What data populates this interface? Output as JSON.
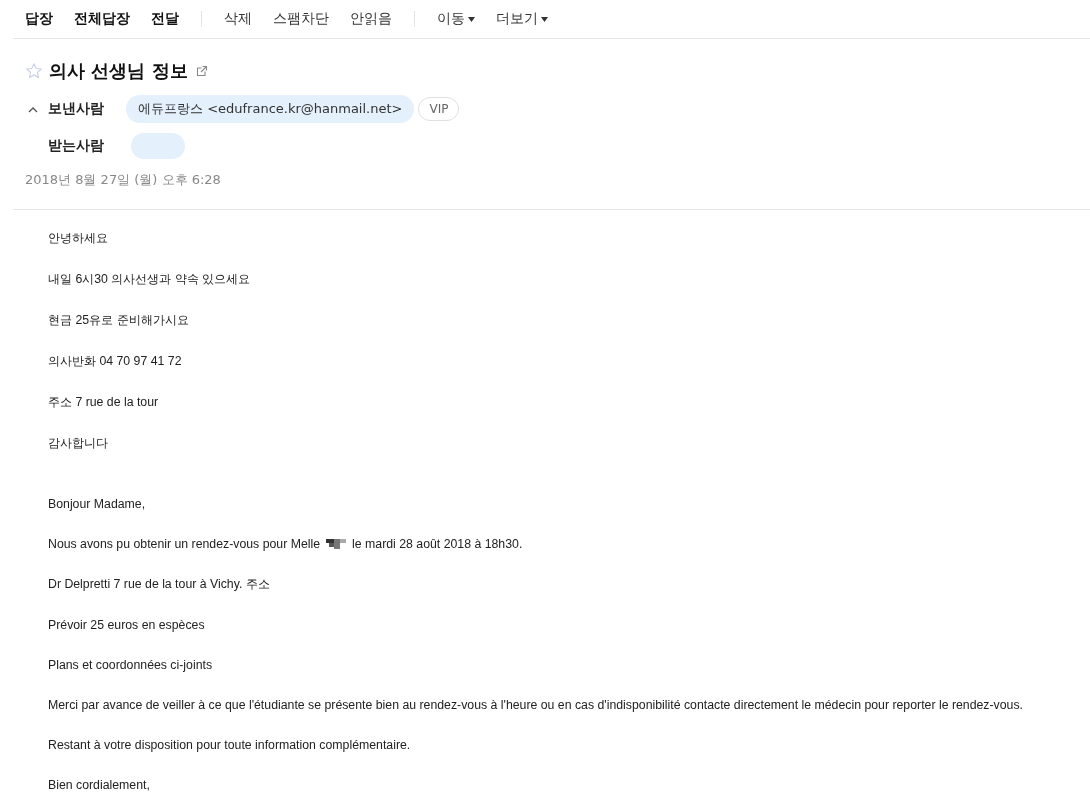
{
  "toolbar": {
    "groups": [
      [
        {
          "label": "답장",
          "kind": "primary"
        },
        {
          "label": "전체답장",
          "kind": "primary"
        },
        {
          "label": "전달",
          "kind": "primary"
        }
      ],
      [
        {
          "label": "삭제",
          "kind": "plain"
        },
        {
          "label": "스팸차단",
          "kind": "plain"
        },
        {
          "label": "안읽음",
          "kind": "plain"
        }
      ],
      [
        {
          "label": "이동",
          "kind": "menu"
        },
        {
          "label": "더보기",
          "kind": "menu"
        }
      ]
    ]
  },
  "message": {
    "subject": "의사 선생님 정보",
    "starred": false,
    "sender_label": "보낸사람",
    "sender": "에듀프랑스 <edufrance.kr@hanmail.net>",
    "vip_badge": "VIP",
    "recipient_label": "받는사람",
    "date": "2018년 8월 27일 (월) 오후 6:28"
  },
  "body": [
    {
      "text": "안녕하세요"
    },
    {
      "text": "내일 6시30 의사선생과 약속 있으세요"
    },
    {
      "text": "현금 25유로 준비해가시요"
    },
    {
      "text": "의사반화 04 70 97 41 72"
    },
    {
      "text": "주소 7 rue de la tour"
    },
    {
      "text": "감사합니다",
      "gap_after": true
    },
    {
      "text": "Bonjour Madame,"
    },
    {
      "text": "Nous avons pu obtenir un rendez-vous pour Melle",
      "redacted": true,
      "text_after": "le mardi 28 août 2018 à 18h30."
    },
    {
      "text": "Dr Delpretti 7 rue de la tour à Vichy. 주소"
    },
    {
      "text": "Prévoir 25 euros en espèces"
    },
    {
      "text": "Plans et coordonnées ci-joints"
    },
    {
      "text": "Merci par avance de veiller à ce que l'étudiante se présente bien au rendez-vous à l'heure ou en cas d'indisponibilité contacte directement le médecin pour reporter le rendez-vous."
    },
    {
      "text": "Restant à votre disposition pour toute information complémentaire."
    },
    {
      "text": "Bien cordialement,"
    }
  ]
}
